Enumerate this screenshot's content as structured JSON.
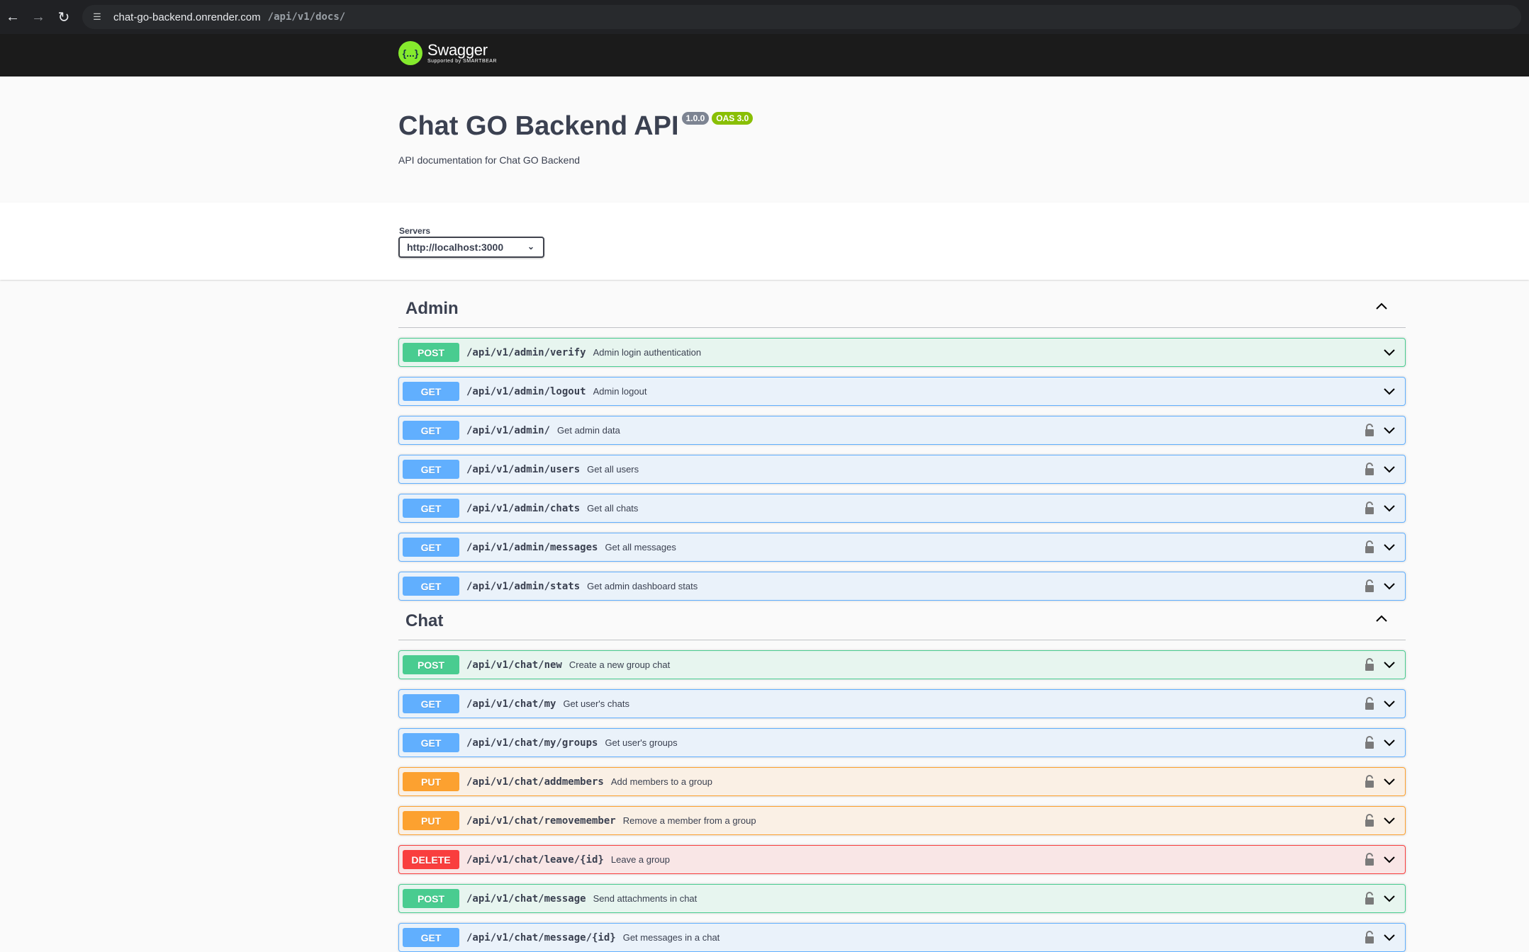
{
  "browser": {
    "url_host": "chat-go-backend.onrender.com",
    "url_path": "/api/v1/docs/"
  },
  "topbar": {
    "logo_name": "Swagger",
    "logo_sub": "Supported by SMARTBEAR",
    "logo_mark": "{...}"
  },
  "info": {
    "title": "Chat GO Backend API",
    "version": "1.0.0",
    "oas": "OAS 3.0",
    "description": "API documentation for Chat GO Backend"
  },
  "servers": {
    "label": "Servers",
    "selected": "http://localhost:3000"
  },
  "tags": [
    {
      "name": "Admin",
      "operations": [
        {
          "method": "POST",
          "path": "/api/v1/admin/verify",
          "summary": "Admin login authentication",
          "locked": false
        },
        {
          "method": "GET",
          "path": "/api/v1/admin/logout",
          "summary": "Admin logout",
          "locked": false
        },
        {
          "method": "GET",
          "path": "/api/v1/admin/",
          "summary": "Get admin data",
          "locked": true
        },
        {
          "method": "GET",
          "path": "/api/v1/admin/users",
          "summary": "Get all users",
          "locked": true
        },
        {
          "method": "GET",
          "path": "/api/v1/admin/chats",
          "summary": "Get all chats",
          "locked": true
        },
        {
          "method": "GET",
          "path": "/api/v1/admin/messages",
          "summary": "Get all messages",
          "locked": true
        },
        {
          "method": "GET",
          "path": "/api/v1/admin/stats",
          "summary": "Get admin dashboard stats",
          "locked": true
        }
      ]
    },
    {
      "name": "Chat",
      "operations": [
        {
          "method": "POST",
          "path": "/api/v1/chat/new",
          "summary": "Create a new group chat",
          "locked": true
        },
        {
          "method": "GET",
          "path": "/api/v1/chat/my",
          "summary": "Get user's chats",
          "locked": true
        },
        {
          "method": "GET",
          "path": "/api/v1/chat/my/groups",
          "summary": "Get user's groups",
          "locked": true
        },
        {
          "method": "PUT",
          "path": "/api/v1/chat/addmembers",
          "summary": "Add members to a group",
          "locked": true
        },
        {
          "method": "PUT",
          "path": "/api/v1/chat/removemember",
          "summary": "Remove a member from a group",
          "locked": true
        },
        {
          "method": "DELETE",
          "path": "/api/v1/chat/leave/{id}",
          "summary": "Leave a group",
          "locked": true
        },
        {
          "method": "POST",
          "path": "/api/v1/chat/message",
          "summary": "Send attachments in chat",
          "locked": true
        },
        {
          "method": "GET",
          "path": "/api/v1/chat/message/{id}",
          "summary": "Get messages in a chat",
          "locked": true
        }
      ]
    }
  ],
  "colors": {
    "post": "#49cc90",
    "get": "#61affe",
    "put": "#fca130",
    "delete": "#f93e3e",
    "swagger_green": "#85ea2d"
  },
  "icons": {
    "back": "arrow-left-icon",
    "forward": "arrow-right-icon",
    "reload": "reload-icon",
    "site_info": "site-info-icon",
    "lock": "lock-icon",
    "expand": "chevron-down-icon",
    "collapse": "chevron-up-icon"
  }
}
